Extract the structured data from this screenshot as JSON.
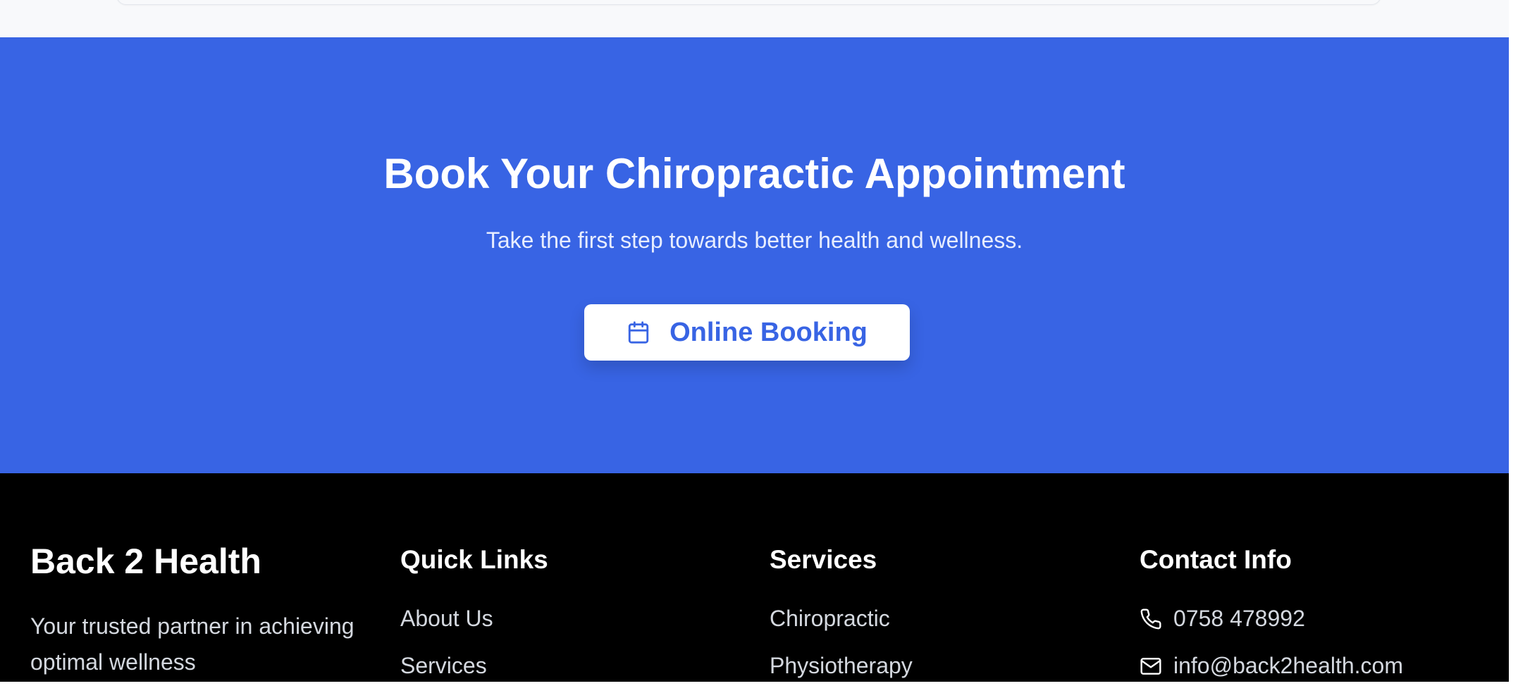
{
  "cta": {
    "title": "Book Your Chiropractic Appointment",
    "subtitle": "Take the first step towards better health and wellness.",
    "button_label": "Online Booking"
  },
  "footer": {
    "brand": "Back 2 Health",
    "brand_description": "Your trusted partner in achieving optimal wellness",
    "quick_links": {
      "title": "Quick Links",
      "items": [
        "About Us",
        "Services"
      ]
    },
    "services": {
      "title": "Services",
      "items": [
        "Chiropractic",
        "Physiotherapy"
      ]
    },
    "contact": {
      "title": "Contact Info",
      "phone": "0758 478992",
      "email": "info@back2health.com"
    }
  },
  "icons": {
    "booking": "calendar-icon",
    "phone": "phone-icon",
    "email": "mail-icon"
  },
  "colors": {
    "accent": "#3864e4",
    "footer_bg": "#000000",
    "footer_text": "#d4d8df"
  }
}
